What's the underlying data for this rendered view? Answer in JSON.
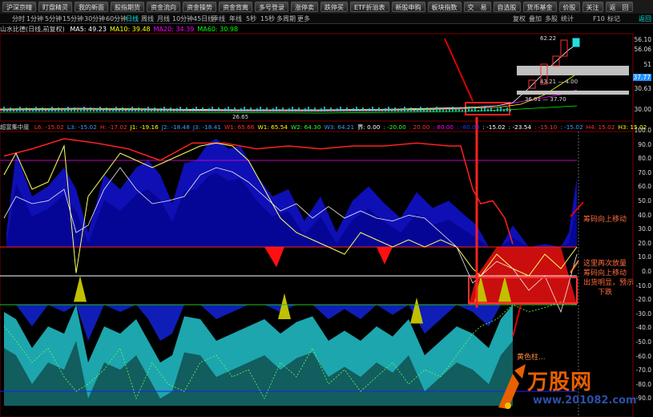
{
  "toolbar": {
    "buttons": [
      "沪深京幢",
      "盯盘精灵",
      "我的新面",
      "股指期货",
      "资金流向",
      "资金操势",
      "资金背离",
      "多号登录",
      "涨停卖",
      "跌停买",
      "ETF折溢表",
      "新股申购",
      "板块指数",
      "交　易",
      "自选股",
      "货币基金",
      "价股",
      "关注",
      "返　回"
    ]
  },
  "periods": {
    "items": [
      "分时",
      "1分钟",
      "5分钟",
      "15分钟",
      "30分钟",
      "60分钟",
      "日线",
      "周线",
      "月线",
      "10分钟",
      "45日线",
      "季线",
      "年线",
      "5秒",
      "15秒",
      "多周期",
      "更多"
    ],
    "active": "日线",
    "right_items": [
      "复权",
      "叠加",
      "多股",
      "统计",
      "F10",
      "标记",
      "返回"
    ]
  },
  "upper_panel": {
    "title": "山水比德(日线,前复权)",
    "ma": [
      {
        "label": "MA5: 49.23",
        "color": "#ffffff"
      },
      {
        "label": "MA10: 39.48",
        "color": "#ffff00"
      },
      {
        "label": "MA20: 34.39",
        "color": "#ff00ff"
      },
      {
        "label": "MA60: 30.98",
        "color": "#00ff00"
      }
    ],
    "axis": [
      "56.10",
      "56.06",
      "51",
      "37.77",
      "30.63",
      "30.00"
    ],
    "price_labels": {
      "high": "62.22",
      "mid": "43.21 — 4.00",
      "low": "36.01 — 37.70",
      "min": "26.65"
    }
  },
  "lower_panel": {
    "title": "超富集中度",
    "items": [
      {
        "label": "L6: -15.02",
        "color": "#ff3030"
      },
      {
        "label": "L3: -15.02",
        "color": "#30a0ff"
      },
      {
        "label": "H: -17.02",
        "color": "#ff3030"
      },
      {
        "label": "J1: -19.16",
        "color": "#ffff00"
      },
      {
        "label": "J2: -18.48",
        "color": "#30a0ff"
      },
      {
        "label": "J3: -18.41",
        "color": "#30a0ff"
      },
      {
        "label": "W1: 65.66",
        "color": "#ff3030"
      },
      {
        "label": "W1: 65.54",
        "color": "#ffff00"
      },
      {
        "label": "W2: 64.30",
        "color": "#30ff30"
      },
      {
        "label": "W3: 64.21",
        "color": "#30a0ff"
      },
      {
        "label": "界: 0.00",
        "color": "#ffffff"
      },
      {
        "label": ": -20.00",
        "color": "#30ff30"
      },
      {
        "label": ": 20.00",
        "color": "#ff3030"
      },
      {
        "label": ": 80.00",
        "color": "#ff00ff"
      },
      {
        "label": ": -80.00",
        "color": "#3030ff"
      },
      {
        "label": ": -15.02",
        "color": "#ffffff"
      },
      {
        "label": ": -23.54",
        "color": "#ffffff"
      },
      {
        "label": ": -15.10",
        "color": "#ff3030"
      },
      {
        "label": ": -15.02",
        "color": "#30a0ff"
      },
      {
        "label": "H4: 15.02",
        "color": "#ff3030"
      },
      {
        "label": "H3: 15.02",
        "color": "#ffff00"
      }
    ],
    "axis": [
      "100.0",
      "90.0",
      "80.0",
      "70.0",
      "60.0",
      "50.0",
      "40.0",
      "30.0",
      "20.0",
      "10.0",
      "0.0",
      "-10.0",
      "-20.0",
      "-30.0",
      "-40.0",
      "-50.0",
      "-60.0",
      "-70.0",
      "-80.0",
      "-90.0"
    ]
  },
  "annotations": {
    "a1": "筹码向上移动",
    "a2_lines": [
      "这里再次放量",
      "筹码向上移动",
      "出货明显，预示",
      "下跌"
    ],
    "a3_lines": [
      "黄色柱..."
    ]
  },
  "logo": {
    "text": "万股网",
    "url": "www.201082.com"
  }
}
